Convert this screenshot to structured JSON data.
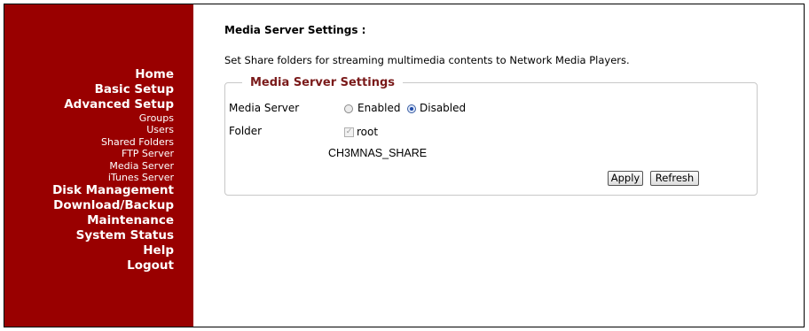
{
  "sidebar": {
    "items": [
      {
        "label": "Home",
        "level": "main"
      },
      {
        "label": "Basic Setup",
        "level": "main"
      },
      {
        "label": "Advanced Setup",
        "level": "main"
      },
      {
        "label": "Groups",
        "level": "sub"
      },
      {
        "label": "Users",
        "level": "sub"
      },
      {
        "label": "Shared Folders",
        "level": "sub"
      },
      {
        "label": "FTP Server",
        "level": "sub"
      },
      {
        "label": "Media Server",
        "level": "sub"
      },
      {
        "label": "iTunes Server",
        "level": "sub"
      },
      {
        "label": "Disk Management",
        "level": "main"
      },
      {
        "label": "Download/Backup",
        "level": "main"
      },
      {
        "label": "Maintenance",
        "level": "main"
      },
      {
        "label": "System Status",
        "level": "main"
      },
      {
        "label": "Help",
        "level": "main"
      },
      {
        "label": "Logout",
        "level": "main"
      }
    ]
  },
  "main": {
    "title": "Media Server Settings :",
    "description": "Set Share folders for streaming multimedia contents to Network Media Players.",
    "section": {
      "legend": "Media Server Settings",
      "media_server_label": "Media Server",
      "enabled_label": "Enabled",
      "disabled_label": "Disabled",
      "selected": "Disabled",
      "folder_label": "Folder",
      "folder_checkbox_label": "root",
      "folder_checked": true,
      "share_name": "CH3MNAS_SHARE"
    },
    "buttons": {
      "apply": "Apply",
      "refresh": "Refresh"
    }
  },
  "colors": {
    "sidebar_bg": "#990000",
    "legend_text": "#7a1a1a"
  }
}
